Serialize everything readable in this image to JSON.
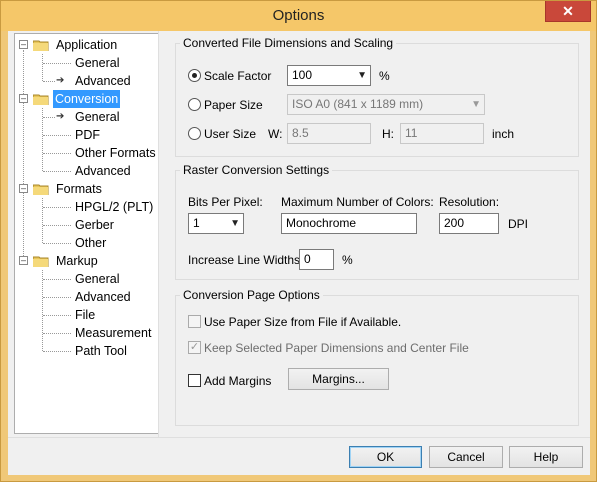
{
  "window": {
    "title": "Options",
    "close_glyph": "✕"
  },
  "tree": {
    "selected": "Conversion",
    "items": [
      {
        "label": "Application",
        "level": 0,
        "expanded": true
      },
      {
        "label": "General",
        "level": 1
      },
      {
        "label": "Advanced",
        "level": 1,
        "current": true
      },
      {
        "label": "Conversion",
        "level": 0,
        "expanded": true,
        "selected": true
      },
      {
        "label": "General",
        "level": 1,
        "current": true
      },
      {
        "label": "PDF",
        "level": 1
      },
      {
        "label": "Other Formats",
        "level": 1
      },
      {
        "label": "Advanced",
        "level": 1
      },
      {
        "label": "Formats",
        "level": 0,
        "expanded": true
      },
      {
        "label": "HPGL/2 (PLT)",
        "level": 1
      },
      {
        "label": "Gerber",
        "level": 1
      },
      {
        "label": "Other",
        "level": 1
      },
      {
        "label": "Markup",
        "level": 0,
        "expanded": true
      },
      {
        "label": "General",
        "level": 1
      },
      {
        "label": "Advanced",
        "level": 1
      },
      {
        "label": "File",
        "level": 1
      },
      {
        "label": "Measurement",
        "level": 1
      },
      {
        "label": "Path Tool",
        "level": 1
      }
    ]
  },
  "dimensions": {
    "title": "Converted File Dimensions and Scaling",
    "scale_factor": {
      "label": "Scale Factor",
      "value": "100",
      "unit": "%",
      "selected": true
    },
    "paper_size": {
      "label": "Paper Size",
      "value": "ISO A0 (841 x 1189 mm)",
      "selected": false
    },
    "user_size": {
      "label": "User Size",
      "w_label": "W:",
      "w_value": "8.5",
      "h_label": "H:",
      "h_value": "11",
      "unit": "inch",
      "selected": false
    }
  },
  "raster": {
    "title": "Raster Conversion Settings",
    "bits_label": "Bits Per Pixel:",
    "bits_value": "1",
    "colors_label": "Maximum Number of Colors:",
    "colors_value": "Monochrome",
    "resolution_label": "Resolution:",
    "resolution_value": "200",
    "resolution_unit": "DPI",
    "line_widths_label": "Increase Line Widths:",
    "line_widths_value": "0",
    "line_widths_unit": "%"
  },
  "page_options": {
    "title": "Conversion Page Options",
    "use_paper_size": {
      "label": "Use Paper Size from File if Available.",
      "checked": false
    },
    "keep_selected": {
      "label": "Keep Selected Paper Dimensions and Center File",
      "checked": true
    },
    "add_margins": {
      "label": "Add Margins",
      "checked": false
    },
    "margins_button": "Margins..."
  },
  "buttons": {
    "ok": "OK",
    "cancel": "Cancel",
    "help": "Help"
  },
  "icons": {
    "folder": "folder-icon",
    "current_arrow": "arrow-right-icon"
  }
}
